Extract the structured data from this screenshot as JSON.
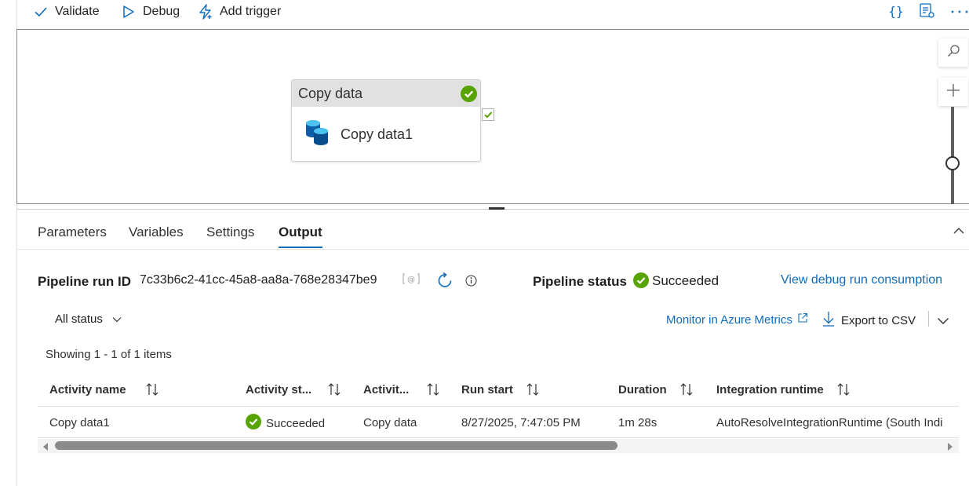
{
  "toolbar": {
    "validate": "Validate",
    "debug": "Debug",
    "add_trigger": "Add trigger"
  },
  "canvas": {
    "activity_type": "Copy data",
    "activity_name": "Copy data1"
  },
  "tabs": [
    "Parameters",
    "Variables",
    "Settings",
    "Output"
  ],
  "output": {
    "run_id_label": "Pipeline run ID",
    "run_id": "7c33b6c2-41cc-45a8-aa8a-768e28347be9",
    "status_label": "Pipeline status",
    "status": "Succeeded",
    "view_consumption": "View debug run consumption",
    "filter": "All status",
    "monitor_link": "Monitor in Azure Metrics",
    "export": "Export to CSV",
    "showing": "Showing 1 - 1 of 1 items",
    "columns": [
      "Activity name",
      "Activity st...",
      "Activit...",
      "Run start",
      "Duration",
      "Integration runtime"
    ],
    "rows": [
      {
        "activity_name": "Copy data1",
        "activity_status": "Succeeded",
        "activity_type": "Copy data",
        "run_start": "8/27/2025, 7:47:05 PM",
        "duration": "1m 28s",
        "runtime": "AutoResolveIntegrationRuntime (South Indi"
      }
    ]
  },
  "colors": {
    "accent": "#0f6cbd",
    "success": "#57a300"
  }
}
